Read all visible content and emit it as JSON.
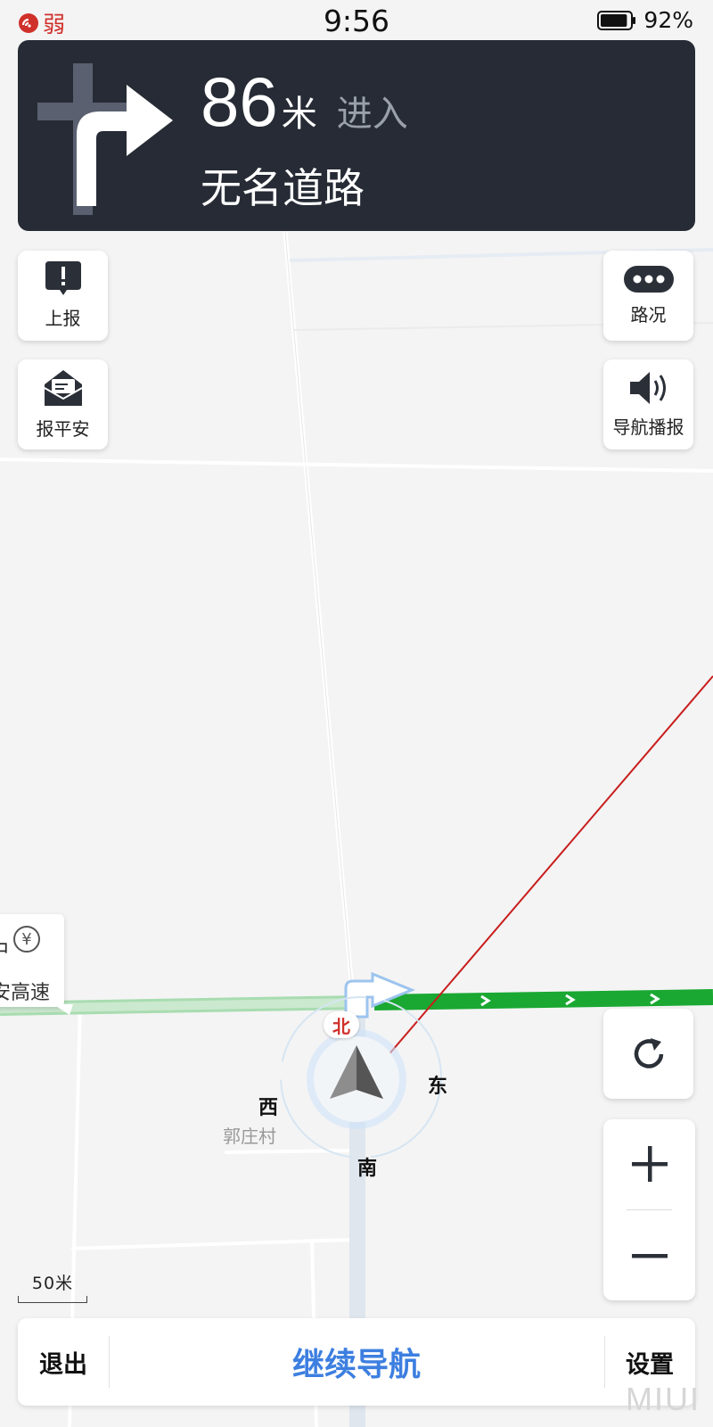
{
  "status_bar": {
    "signal_label": "弱",
    "time": "9:56",
    "battery_percent": "92%",
    "battery_level": 0.92,
    "signal_color": "#d0302a"
  },
  "guidance": {
    "distance_value": "86",
    "distance_unit": "米",
    "action": "进入",
    "road_name": "无名道路",
    "turn_icon": "turn-right-arrow-icon"
  },
  "left_buttons": [
    {
      "label": "上报",
      "icon": "report-alert-icon"
    },
    {
      "label": "报平安",
      "icon": "safety-envelope-icon"
    }
  ],
  "right_buttons": [
    {
      "label": "路况",
      "icon": "traffic-more-icon"
    },
    {
      "label": "导航播报",
      "icon": "speaker-icon"
    }
  ],
  "map": {
    "poi_top": "中",
    "poi_name": "安高速",
    "poi_icon": "yuan-toll-icon",
    "village": "郭庄村",
    "compass": {
      "north": "北",
      "east": "东",
      "south": "南",
      "west": "西"
    },
    "scale_label": "50米",
    "route_color": "#1aa832"
  },
  "controls": {
    "refresh_icon": "refresh-icon",
    "zoom_in_icon": "plus-icon",
    "zoom_out_icon": "minus-icon"
  },
  "bottom_bar": {
    "exit_label": "退出",
    "continue_label": "继续导航",
    "settings_label": "设置",
    "accent_color": "#3d7fe0"
  },
  "watermark": "MIUI"
}
